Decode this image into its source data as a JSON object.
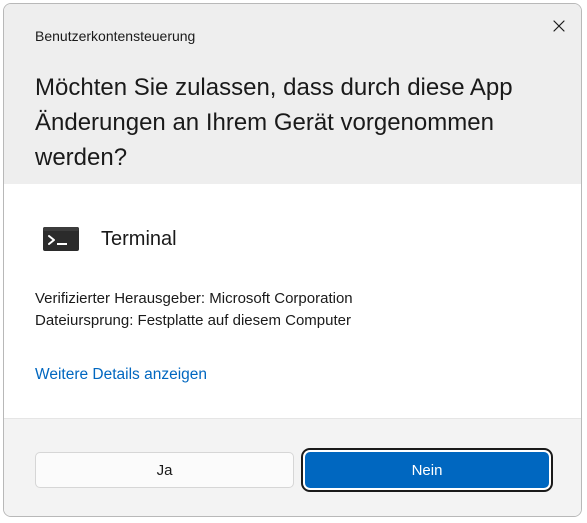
{
  "dialog": {
    "window_title": "Benutzerkontensteuerung",
    "question": "Möchten Sie zulassen, dass durch diese App Änderungen an Ihrem Gerät vorgenommen werden?",
    "close_icon": "close-icon"
  },
  "app": {
    "icon": "terminal-icon",
    "name": "Terminal"
  },
  "info": {
    "publisher": "Verifizierter Herausgeber: Microsoft Corporation",
    "origin": "Dateiursprung: Festplatte auf diesem Computer"
  },
  "details_link": "Weitere Details anzeigen",
  "buttons": {
    "yes": "Ja",
    "no": "Nein"
  },
  "colors": {
    "accent": "#0067c0",
    "header_bg": "#eeeeee",
    "footer_bg": "#f3f3f3"
  }
}
